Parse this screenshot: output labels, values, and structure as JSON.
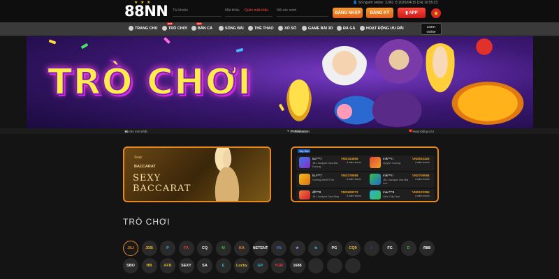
{
  "header": {
    "logo": "88NN",
    "username_placeholder": "Tài khoản",
    "password_placeholder": "Mật khẩu",
    "forgot_password": "Quên mật khẩu",
    "captcha_placeholder": "Mã xác minh",
    "online_status": "Số người online: 3,961",
    "datetime": "2025/04/15 (14) 10:55:23",
    "login_label": "ĐĂNG NHẬP",
    "register_label": "ĐĂNG KÝ",
    "app_label": "APP"
  },
  "nav": {
    "items": [
      {
        "label": "TRANG CHỦ",
        "icon": "home-icon"
      },
      {
        "label": "TRÒ CHƠI",
        "icon": "slot-icon",
        "badge": "HOT"
      },
      {
        "label": "BẮN CÁ",
        "icon": "fish-icon",
        "badge": "HOT"
      },
      {
        "label": "SÒNG BÀI",
        "icon": "casino-icon"
      },
      {
        "label": "THỂ THAO",
        "icon": "soccer-icon"
      },
      {
        "label": "XỔ SỐ",
        "icon": "lottery-icon"
      },
      {
        "label": "GAME BÀI 3D",
        "icon": "cards-icon"
      },
      {
        "label": "ĐÁ GÀ",
        "icon": "rooster-icon"
      },
      {
        "label": "HOẠT ĐỘNG ƯU ĐÃI",
        "icon": "gift-icon"
      }
    ],
    "support_line1": "CSKH",
    "support_line2": "Online"
  },
  "banner": {
    "title": "TRÒ CHƠI"
  },
  "ticker": {
    "news": "Tin tức mới nhất",
    "url_label": "URL Dễ Nhớ",
    "url1": "88nn.com",
    "url2": "8n8n.com",
    "partner": "Hoạt Động Ưu!"
  },
  "promo": {
    "brand": "Sexy",
    "brand_sub": "BACCARAT",
    "title_line1": "SEXY",
    "title_line2": "BACCARAT"
  },
  "winners": {
    "tab": "Top Win",
    "rows": [
      {
        "left": {
          "name": "iuc***7",
          "game": "JILI Jackpot Vua Bai Duong",
          "amount": "VND344858",
          "time": "4 năm trước"
        },
        "right": {
          "name": "mik***n",
          "game": "Quyền Vương",
          "amount": "VND633425",
          "time": "4 năm trước"
        }
      },
      {
        "left": {
          "name": "lcu***7",
          "game": "Vương bài tổ Fun",
          "amount": "VND378858",
          "time": "4 năm trước"
        },
        "right": {
          "name": "mik***n",
          "game": "JILI Jackpot Vua Bai Luc",
          "amount": "VND705568",
          "time": "4 năm trước"
        }
      },
      {
        "left": {
          "name": "dll***8",
          "game": "JILI Jackpot Vua May",
          "amount": "VND608272",
          "time": "4 năm trước"
        },
        "right": {
          "name": "mac***8",
          "game": "Siêu Cấp Ace",
          "amount": "VND122355",
          "time": "4 năm trước"
        }
      }
    ]
  },
  "games_section": {
    "title": "TRÒ CHƠI"
  },
  "providers": [
    {
      "label": "JILI",
      "color": "#e8871e"
    },
    {
      "label": "JDB",
      "color": "#f0b429"
    },
    {
      "label": "P",
      "color": "#35b8e0"
    },
    {
      "label": "FA",
      "color": "#e23b3b"
    },
    {
      "label": "CQ",
      "color": "#f2f2f2"
    },
    {
      "label": "M",
      "color": "#35c04a"
    },
    {
      "label": "KA",
      "color": "#f08a24"
    },
    {
      "label": "NETENT",
      "color": "#f2f2f2"
    },
    {
      "label": "VA",
      "color": "#3b7be2"
    },
    {
      "label": "★",
      "color": "#b38cff"
    },
    {
      "label": "≋",
      "color": "#35b8e0"
    },
    {
      "label": "PG",
      "color": "#f2f2f2"
    },
    {
      "label": "CQ9",
      "color": "#e8c22a"
    },
    {
      "label": "⁄",
      "color": "#8a3ce2"
    },
    {
      "label": "FC",
      "color": "#ffffff"
    },
    {
      "label": "D",
      "color": "#35c04a"
    },
    {
      "label": "R88",
      "color": "#ffffff"
    },
    {
      "label": "SBO",
      "color": "#f2f2f2"
    },
    {
      "label": "HB",
      "color": "#e8c22a"
    },
    {
      "label": "AFB",
      "color": "#d4a63a"
    },
    {
      "label": "SEXY",
      "color": "#f2f2f2"
    },
    {
      "label": "SA",
      "color": "#f2f2f2"
    },
    {
      "label": "E",
      "color": "#35b8e0"
    },
    {
      "label": "Lucky",
      "color": "#e8c22a"
    },
    {
      "label": "GP",
      "color": "#35b8e0"
    },
    {
      "label": "YGR",
      "color": "#e23b3b"
    },
    {
      "label": "1688",
      "color": "#f2f2f2"
    },
    {
      "label": "",
      "color": "#2a2a2a"
    },
    {
      "label": "",
      "color": "#2a2a2a"
    },
    {
      "label": "",
      "color": "#2a2a2a"
    }
  ]
}
